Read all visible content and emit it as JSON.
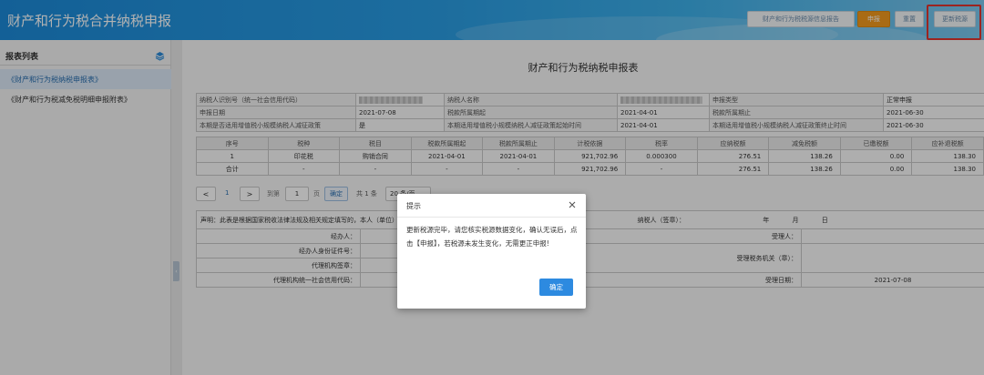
{
  "header": {
    "title": "财产和行为税合并纳税申报",
    "buttons": {
      "source_report": "财产和行为税税源信息报告",
      "declare": "申报",
      "reset": "重置",
      "update_source": "更新税源"
    }
  },
  "sidebar": {
    "title": "报表列表",
    "items": [
      {
        "label": "《财产和行为税纳税申报表》"
      },
      {
        "label": "《财产和行为税减免税明细申报附表》"
      }
    ]
  },
  "form": {
    "title": "财产和行为税纳税申报表",
    "info": {
      "taxpayer_id_label": "纳税人识别号（统一社会信用代码）",
      "taxpayer_name_label": "纳税人名称",
      "declare_type_label": "申报类型",
      "declare_type_value": "正常申报",
      "declare_date_label": "申报日期",
      "declare_date_value": "2021-07-08",
      "period_start_label": "税款所属期起",
      "period_start_value": "2021-04-01",
      "period_end_label": "税款所属期止",
      "period_end_value": "2021-06-30",
      "small_taxpayer_label": "本期是否适用增值税小规模纳税人减征政策",
      "small_taxpayer_value": "是",
      "policy_start_label": "本期适用增值税小规模纳税人减征政策起始时间",
      "policy_start_value": "2021-04-01",
      "policy_end_label": "本期适用增值税小规模纳税人减征政策终止时间",
      "policy_end_value": "2021-06-30"
    },
    "table": {
      "headers": [
        "序号",
        "税种",
        "税目",
        "税款所属期起",
        "税款所属期止",
        "计税依据",
        "税率",
        "应纳税额",
        "减免税额",
        "已缴税额",
        "应补退税额"
      ],
      "rows": [
        [
          "1",
          "印花税",
          "购销合同",
          "2021-04-01",
          "2021-04-01",
          "921,702.96",
          "0.000300",
          "276.51",
          "138.26",
          "0.00",
          "138.30"
        ],
        [
          "合计",
          "-",
          "-",
          "-",
          "-",
          "921,702.96",
          "-",
          "276.51",
          "138.26",
          "0.00",
          "138.30"
        ]
      ]
    },
    "pager": {
      "prev": "<",
      "current_page": "1",
      "next": ">",
      "goto_label": "到第",
      "goto_value": "1",
      "page_unit": "页",
      "confirm": "确定",
      "total": "共 1 条",
      "page_size": "20 条/页"
    },
    "declaration": {
      "statement": "声明：此表是根据国家税收法律法规及相关规定填写的，本人（单位）对",
      "taxpayer_sign": "纳税人（签章）：",
      "year": "年",
      "month": "月",
      "day": "日",
      "handler": "经办人：",
      "handler_id": "经办人身份证件号：",
      "agency_sign": "代理机构签章：",
      "agency_credit": "代理机构统一社会信用代码：",
      "receiver": "受理人：",
      "receiver_office": "受理税务机关（章）：",
      "receive_date": "受理日期：",
      "receive_date_value": "2021-07-08"
    }
  },
  "dialog": {
    "title": "提示",
    "message": "更新税源完毕，请您核实税源数据变化，确认无误后，点击【申报】，若税源未发生变化，无需更正申报!",
    "ok": "确定"
  },
  "colors": {
    "header_blue": "#1c8ad8",
    "accent_orange": "#f29a1d",
    "highlight_red": "#e0342f",
    "button_blue": "#2d8ae0"
  }
}
